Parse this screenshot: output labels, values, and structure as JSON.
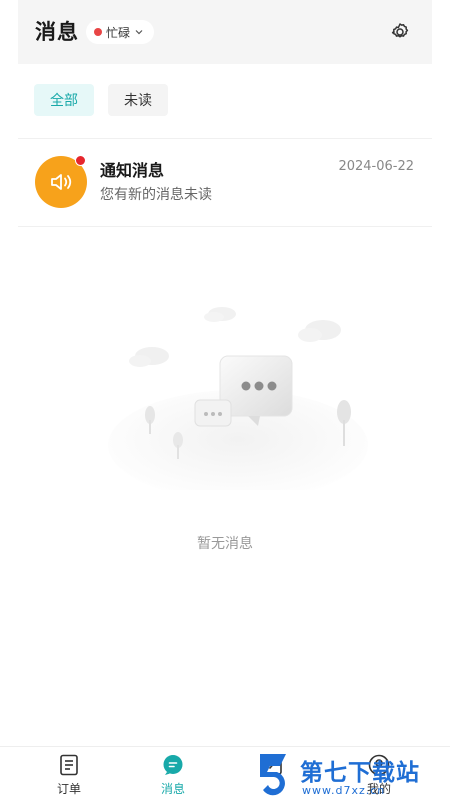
{
  "header": {
    "title": "消息",
    "status_label": "忙碌",
    "status_color": "#e84545",
    "settings_icon": "gear-icon"
  },
  "tabs": [
    {
      "label": "全部",
      "active": true
    },
    {
      "label": "未读",
      "active": false
    }
  ],
  "messages": [
    {
      "title": "通知消息",
      "subtitle": "您有新的消息未读",
      "date": "2024-06-22",
      "icon": "speaker-icon",
      "unread": true
    }
  ],
  "empty_state": {
    "text": "暂无消息"
  },
  "bottom_nav": [
    {
      "label": "订单",
      "icon": "document-icon",
      "active": false
    },
    {
      "label": "消息",
      "icon": "chat-bubble-icon",
      "active": true
    },
    {
      "label": "",
      "icon": "edit-icon",
      "active": false
    },
    {
      "label": "我的",
      "icon": "profile-icon",
      "active": false
    }
  ],
  "watermark": {
    "brand": "第七下载站",
    "url": "www.d7xz.cn"
  },
  "colors": {
    "accent": "#18a9a9",
    "notify_orange": "#f7a21b",
    "badge_red": "#e6262d",
    "watermark_blue": "#1f6ed4"
  }
}
